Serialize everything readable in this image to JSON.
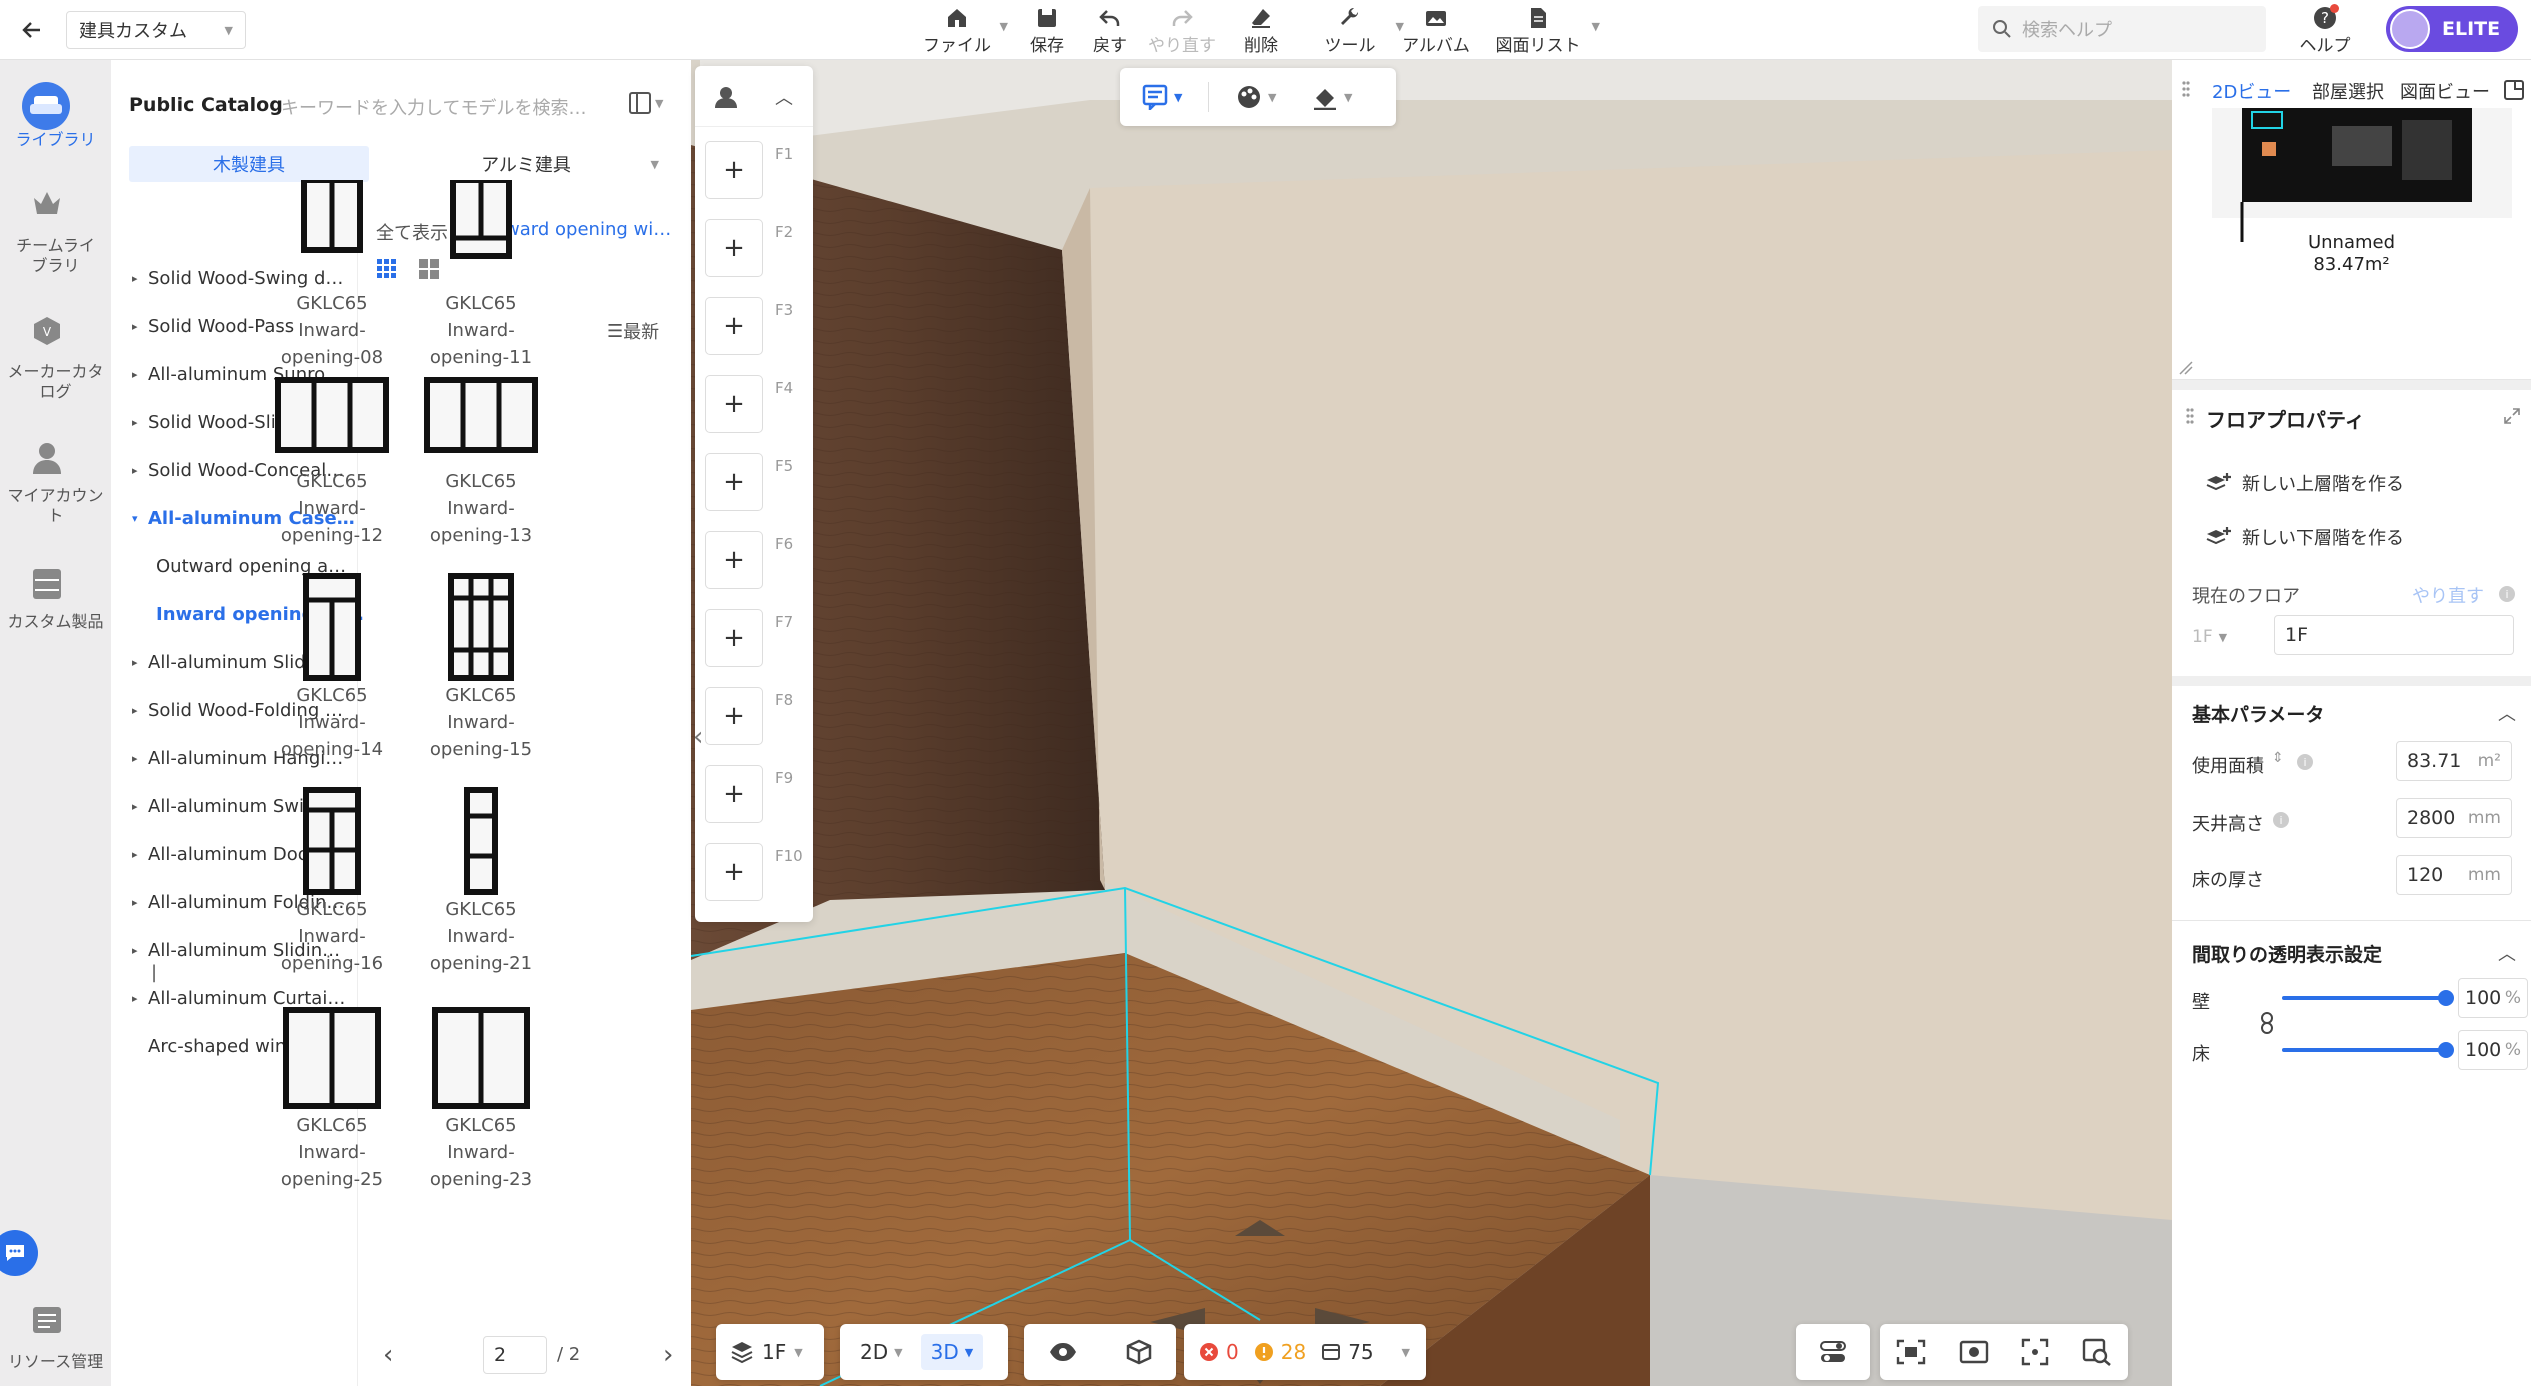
{
  "topbar": {
    "project_name": "建具カスタム",
    "tools": [
      {
        "label": "ファイル",
        "icon": "house-icon",
        "has_menu": true
      },
      {
        "label": "保存",
        "icon": "save-icon",
        "has_menu": false
      },
      {
        "label": "戻す",
        "icon": "undo-icon",
        "has_menu": false
      },
      {
        "label": "やり直す",
        "icon": "redo-icon",
        "has_menu": false,
        "disabled": true
      },
      {
        "label": "削除",
        "icon": "eraser-icon",
        "has_menu": false
      },
      {
        "label": "ツール",
        "icon": "wrench-icon",
        "has_menu": true
      },
      {
        "label": "アルバム",
        "icon": "album-icon",
        "has_menu": false
      },
      {
        "label": "図面リスト",
        "icon": "drawing-list-icon",
        "has_menu": true
      }
    ],
    "search_placeholder": "検索ヘルプ",
    "help_label": "ヘルプ",
    "badge": "ELITE"
  },
  "left_nav": [
    {
      "label": "ライブラリ",
      "icon": "sofa-icon",
      "active": true
    },
    {
      "label": "チームライブラリ",
      "icon": "crown-icon",
      "active": false
    },
    {
      "label": "メーカーカタログ",
      "icon": "catalog-icon",
      "active": false
    },
    {
      "label": "マイアカウント",
      "icon": "user-icon",
      "active": false
    },
    {
      "label": "カスタム製品",
      "icon": "cabinet-icon",
      "active": false
    }
  ],
  "left_nav_bottom": {
    "label": "リソース管理",
    "icon": "resource-icon"
  },
  "library": {
    "title": "Public Catalog",
    "search_placeholder": "キーワードを入力してモデルを検索…",
    "tabs": [
      "木製建具",
      "アルミ建具"
    ],
    "categories": [
      {
        "label": "Solid Wood-Swing d…",
        "arrow": "▸"
      },
      {
        "label": "Solid Wood-Pass",
        "arrow": "▸"
      },
      {
        "label": "All-aluminum Sunro…",
        "arrow": "▸"
      },
      {
        "label": "Solid Wood-Sliding …",
        "arrow": "▸"
      },
      {
        "label": "Solid Wood-Conceal…",
        "arrow": "▸"
      },
      {
        "label": "All-aluminum Case…",
        "arrow": "▾",
        "active": true
      },
      {
        "label": "Outward opening a…",
        "arrow": "",
        "child": true
      },
      {
        "label": "Inward opening an…",
        "arrow": "",
        "child": true,
        "active": true
      },
      {
        "label": "All-aluminum Slidin…",
        "arrow": "▸"
      },
      {
        "label": "Solid Wood-Folding …",
        "arrow": "▸"
      },
      {
        "label": "All-aluminum Hangi…",
        "arrow": "▸"
      },
      {
        "label": "All-aluminum Swing …",
        "arrow": "▸"
      },
      {
        "label": "All-aluminum Door …",
        "arrow": "▸"
      },
      {
        "label": "All-aluminum Foldin…",
        "arrow": "▸"
      },
      {
        "label": "All-aluminum Slidin…",
        "arrow": "▸"
      },
      {
        "label": "All-aluminum Curtai…",
        "arrow": "▸"
      },
      {
        "label": "Arc-shaped window",
        "arrow": ""
      }
    ],
    "show_all": "全て表示",
    "current_category": "65 inward opening wi…",
    "sort_label": "最新",
    "products": [
      {
        "line1": "GKLC65 Inward-",
        "line2": "opening-08"
      },
      {
        "line1": "GKLC65 Inward-",
        "line2": "opening-11"
      },
      {
        "line1": "GKLC65 Inward-",
        "line2": "opening-12"
      },
      {
        "line1": "GKLC65 Inward-",
        "line2": "opening-13"
      },
      {
        "line1": "GKLC65 Inward-",
        "line2": "opening-14"
      },
      {
        "line1": "GKLC65 Inward-",
        "line2": "opening-15"
      },
      {
        "line1": "GKLC65 Inward-",
        "line2": "opening-16"
      },
      {
        "line1": "GKLC65 Inward-",
        "line2": "opening-21"
      },
      {
        "line1": "GKLC65 Inward-",
        "line2": "opening-25"
      },
      {
        "line1": "GKLC65 Inward-",
        "line2": "opening-23"
      }
    ],
    "pagination": {
      "current": "2",
      "total": "/ 2"
    }
  },
  "favorites": {
    "labels": [
      "F1",
      "F2",
      "F3",
      "F4",
      "F5",
      "F6",
      "F7",
      "F8",
      "F9",
      "F10"
    ]
  },
  "bottom_toolbar": {
    "floor": "1F",
    "mode_2d": "2D",
    "mode_3d": "3D",
    "errors": "0",
    "warnings": "28",
    "info_count": "75"
  },
  "right_panel": {
    "view_tabs": [
      "2Dビュー",
      "部屋選択",
      "図面ビュー"
    ],
    "minimap_name": "Unnamed",
    "minimap_area": "83.47m²",
    "title": "フロアプロパティ",
    "add_upper": "新しい上層階を作る",
    "add_lower": "新しい下層階を作る",
    "current_floor_label": "現在のフロア",
    "redo_label": "やり直す",
    "floor_select": "1F",
    "floor_name": "1F",
    "basic_params": "基本パラメータ",
    "area_label": "使用面積",
    "area_value": "83.71",
    "area_unit": "m²",
    "ceiling_label": "天井高さ",
    "ceiling_value": "2800",
    "ceiling_unit": "mm",
    "floor_thickness_label": "床の厚さ",
    "floor_thickness_value": "120",
    "floor_thickness_unit": "mm",
    "transparency_title": "間取りの透明表示設定",
    "wall_label": "壁",
    "wall_value": "100",
    "floor_label": "床",
    "floor_value": "100",
    "pct": "%"
  },
  "colors": {
    "accent": "#2a6fe8",
    "highlight": "#22d3e6",
    "elite": "#6a4be0",
    "error": "#e84a3c",
    "warning": "#f0a020"
  }
}
